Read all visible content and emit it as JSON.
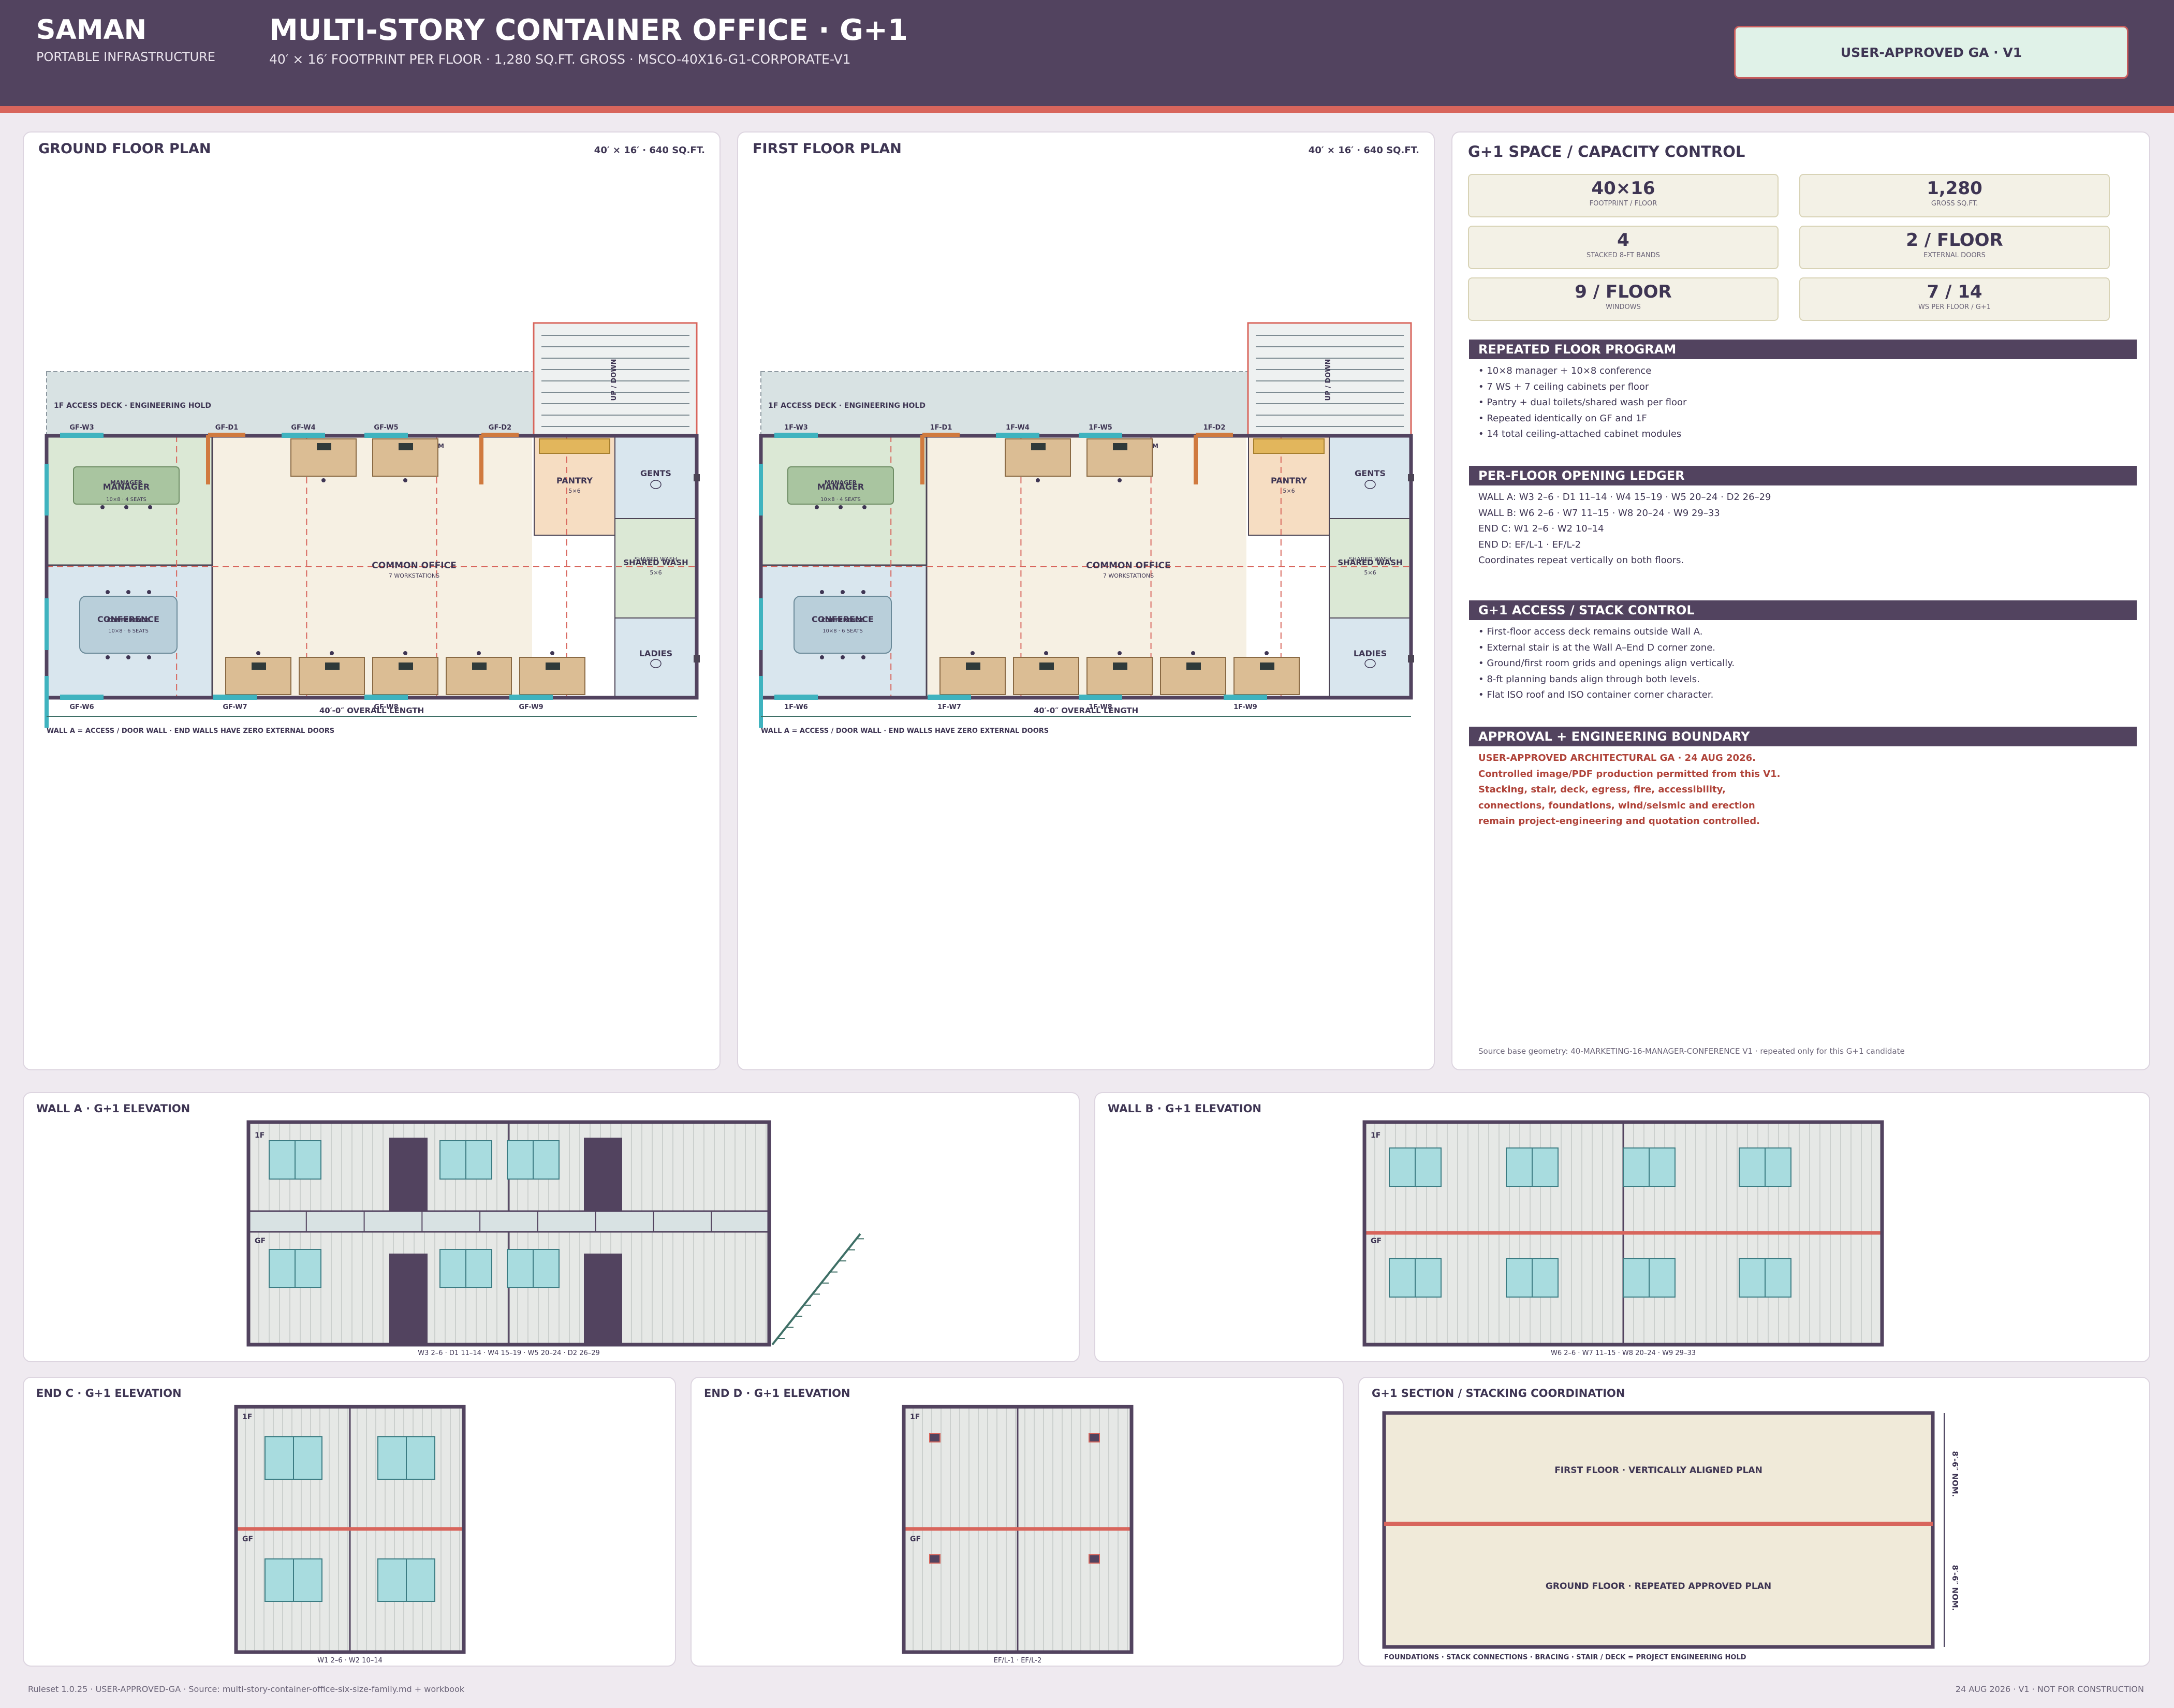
{
  "header": {
    "brand": "SAMAN",
    "brand_sub": "PORTABLE INFRASTRUCTURE",
    "title": "MULTI-STORY CONTAINER OFFICE · G+1",
    "subtitle": "40′ × 16′ FOOTPRINT PER FLOOR · 1,280 SQ.FT. GROSS · MSCO-40X16-G1-CORPORATE-V1",
    "badge": "USER-APPROVED GA · V1"
  },
  "colors": {
    "header": "#52435f",
    "accent": "#d8655c",
    "badge_bg": "#e0f2e8"
  },
  "plans": [
    {
      "title": "GROUND FLOOR PLAN",
      "size_note": "40′ × 16′ · 640 SQ.FT.",
      "deck": "1F ACCESS DECK · ENGINEERING HOLD",
      "stair": "UP / DOWN",
      "top_openings": [
        "GF-W3",
        "GF-D1",
        "GF-W4",
        "GF-W5",
        "GF-D2"
      ],
      "bottom_openings": [
        "GF-W6",
        "GF-W7",
        "GF-W8",
        "GF-W9"
      ],
      "manager_a": "MANAGER",
      "manager_b": "MANAGER",
      "manager_sub": "10×8 · 4 SEATS",
      "conf_a": "CONFERENCE",
      "conf_b": "CONFERENCE",
      "conf_sub": "10×8 · 6 SEATS",
      "common": "COMMON OFFICE",
      "common_sub": "7 WORKSTATIONS",
      "pantry": "PANTRY",
      "pantry_sub": "5×6",
      "gents": "GENTS",
      "shared_a": "SHARED WASH",
      "shared_b": "SHARED WASH",
      "shared_sub": "5×6",
      "ladies": "LADIES",
      "m_mark": "M",
      "overall": "40′-0″ OVERALL LENGTH",
      "wall_note": "WALL A = ACCESS / DOOR WALL · END WALLS HAVE ZERO EXTERNAL DOORS"
    },
    {
      "title": "FIRST FLOOR PLAN",
      "size_note": "40′ × 16′ · 640 SQ.FT.",
      "deck": "1F ACCESS DECK · ENGINEERING HOLD",
      "stair": "UP / DOWN",
      "top_openings": [
        "1F-W3",
        "1F-D1",
        "1F-W4",
        "1F-W5",
        "1F-D2"
      ],
      "bottom_openings": [
        "1F-W6",
        "1F-W7",
        "1F-W8",
        "1F-W9"
      ],
      "manager_a": "MANAGER",
      "manager_b": "MANAGER",
      "manager_sub": "10×8 · 4 SEATS",
      "conf_a": "CONFERENCE",
      "conf_b": "CONFERENCE",
      "conf_sub": "10×8 · 6 SEATS",
      "common": "COMMON OFFICE",
      "common_sub": "7 WORKSTATIONS",
      "pantry": "PANTRY",
      "pantry_sub": "5×6",
      "gents": "GENTS",
      "shared_a": "SHARED WASH",
      "shared_b": "SHARED WASH",
      "shared_sub": "5×6",
      "ladies": "LADIES",
      "m_mark": "M",
      "overall": "40′-0″ OVERALL LENGTH",
      "wall_note": "WALL A = ACCESS / DOOR WALL · END WALLS HAVE ZERO EXTERNAL DOORS"
    }
  ],
  "control": {
    "title": "G+1 SPACE / CAPACITY CONTROL",
    "stats": [
      {
        "value": "40×16",
        "label": "FOOTPRINT / FLOOR"
      },
      {
        "value": "1,280",
        "label": "GROSS SQ.FT."
      },
      {
        "value": "4",
        "label": "STACKED 8-FT BANDS"
      },
      {
        "value": "2 / FLOOR",
        "label": "EXTERNAL DOORS"
      },
      {
        "value": "9 / FLOOR",
        "label": "WINDOWS"
      },
      {
        "value": "7 / 14",
        "label": "WS PER FLOOR / G+1"
      }
    ],
    "sections": [
      {
        "title": "REPEATED FLOOR PROGRAM",
        "lines": [
          "• 10×8 manager + 10×8 conference",
          "• 7 WS + 7 ceiling cabinets per floor",
          "• Pantry + dual toilets/shared wash per floor",
          "• Repeated identically on GF and 1F",
          "• 14 total ceiling-attached cabinet modules"
        ]
      },
      {
        "title": "PER-FLOOR OPENING LEDGER",
        "lines": [
          "WALL A: W3 2–6 · D1 11–14 · W4 15–19 · W5 20–24 · D2 26–29",
          "WALL B: W6 2–6 · W7 11–15 · W8 20–24 · W9 29–33",
          "END C: W1 2–6 · W2 10–14",
          "END D: EF/L-1 · EF/L-2",
          "Coordinates repeat vertically on both floors."
        ]
      },
      {
        "title": "G+1 ACCESS / STACK CONTROL",
        "lines": [
          "• First-floor access deck remains outside Wall A.",
          "• External stair is at the Wall A–End D corner zone.",
          "• Ground/first room grids and openings align vertically.",
          "• 8-ft planning bands align through both levels.",
          "• Flat ISO roof and ISO container corner character."
        ]
      },
      {
        "title": "APPROVAL + ENGINEERING BOUNDARY",
        "lines": [
          "USER-APPROVED ARCHITECTURAL GA · 24 AUG 2026.",
          "Controlled image/PDF production permitted from this V1.",
          "Stacking, stair, deck, egress, fire, accessibility,",
          "connections, foundations, wind/seismic and erection",
          "remain project-engineering and quotation controlled."
        ]
      }
    ],
    "source_note": "Source base geometry: 40-MARKETING-16-MANAGER-CONFERENCE V1 · repeated only for this G+1 candidate"
  },
  "elevations": {
    "wall_a": {
      "title": "WALL A · G+1 ELEVATION",
      "caption": "W3 2–6 · D1 11–14 · W4 15–19 · W5 20–24 · D2 26–29"
    },
    "wall_b": {
      "title": "WALL B · G+1 ELEVATION",
      "caption": "W6 2–6 · W7 11–15 · W8 20–24 · W9 29–33"
    },
    "end_c": {
      "title": "END C · G+1 ELEVATION",
      "caption": "W1 2–6 · W2 10–14"
    },
    "end_d": {
      "title": "END D · G+1 ELEVATION",
      "caption": "EF/L-1 · EF/L-2"
    },
    "floor_1f": "1F",
    "floor_gf": "GF"
  },
  "section": {
    "title": "G+1 SECTION / STACKING COORDINATION",
    "first": "FIRST FLOOR · VERTICALLY ALIGNED PLAN",
    "ground": "GROUND FLOOR · REPEATED APPROVED PLAN",
    "dim": "8′-6″ NOM.",
    "note": "FOUNDATIONS · STACK CONNECTIONS · BRACING · STAIR / DECK = PROJECT ENGINEERING HOLD"
  },
  "footer": {
    "left": "Ruleset 1.0.25 · USER-APPROVED-GA · Source: multi-story-container-office-six-size-family.md + workbook",
    "right": "24 AUG 2026 · V1 · NOT FOR CONSTRUCTION"
  }
}
